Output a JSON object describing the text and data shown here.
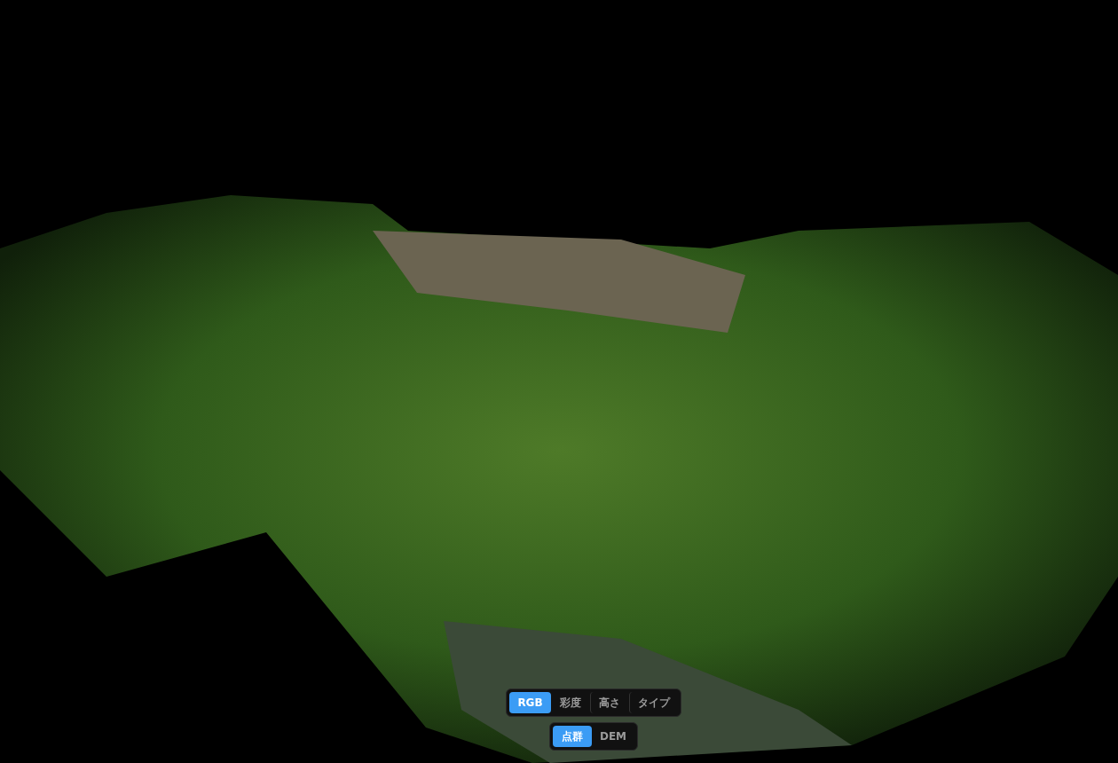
{
  "color_modes": [
    {
      "label": "RGB",
      "selected": true
    },
    {
      "label": "彩度",
      "selected": false
    },
    {
      "label": "高さ",
      "selected": false
    },
    {
      "label": "タイプ",
      "selected": false
    }
  ],
  "view_modes": [
    {
      "label": "点群",
      "selected": true
    },
    {
      "label": "DEM",
      "selected": false
    }
  ]
}
